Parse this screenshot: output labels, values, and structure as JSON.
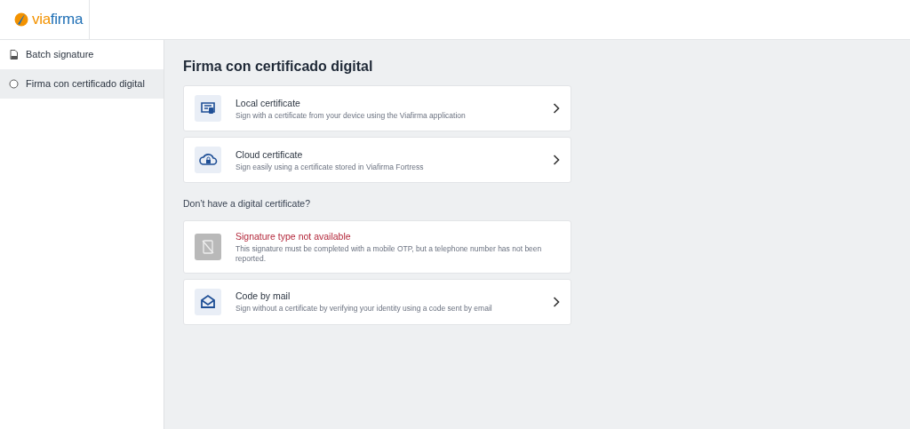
{
  "logo": {
    "text_prefix": "via",
    "text_suffix": "firma"
  },
  "sidebar": {
    "items": [
      {
        "label": "Batch signature",
        "selected": false
      },
      {
        "label": "Firma con certificado digital",
        "selected": true
      }
    ]
  },
  "main": {
    "title": "Firma con certificado digital",
    "options": [
      {
        "title": "Local certificate",
        "description": "Sign with a certificate from your device using the Viafirma application",
        "disabled": false
      },
      {
        "title": "Cloud certificate",
        "description": "Sign easily using a certificate stored in Viafirma Fortress",
        "disabled": false
      }
    ],
    "alternatives_heading": "Don’t have a digital certificate?",
    "alternatives": [
      {
        "title": "Signature type not available",
        "description": "This signature must be completed with a mobile OTP, but a telephone number has not been reported.",
        "disabled": true
      },
      {
        "title": "Code by mail",
        "description": "Sign without a certificate by verifying your identity using a code sent by email",
        "disabled": false
      }
    ]
  }
}
